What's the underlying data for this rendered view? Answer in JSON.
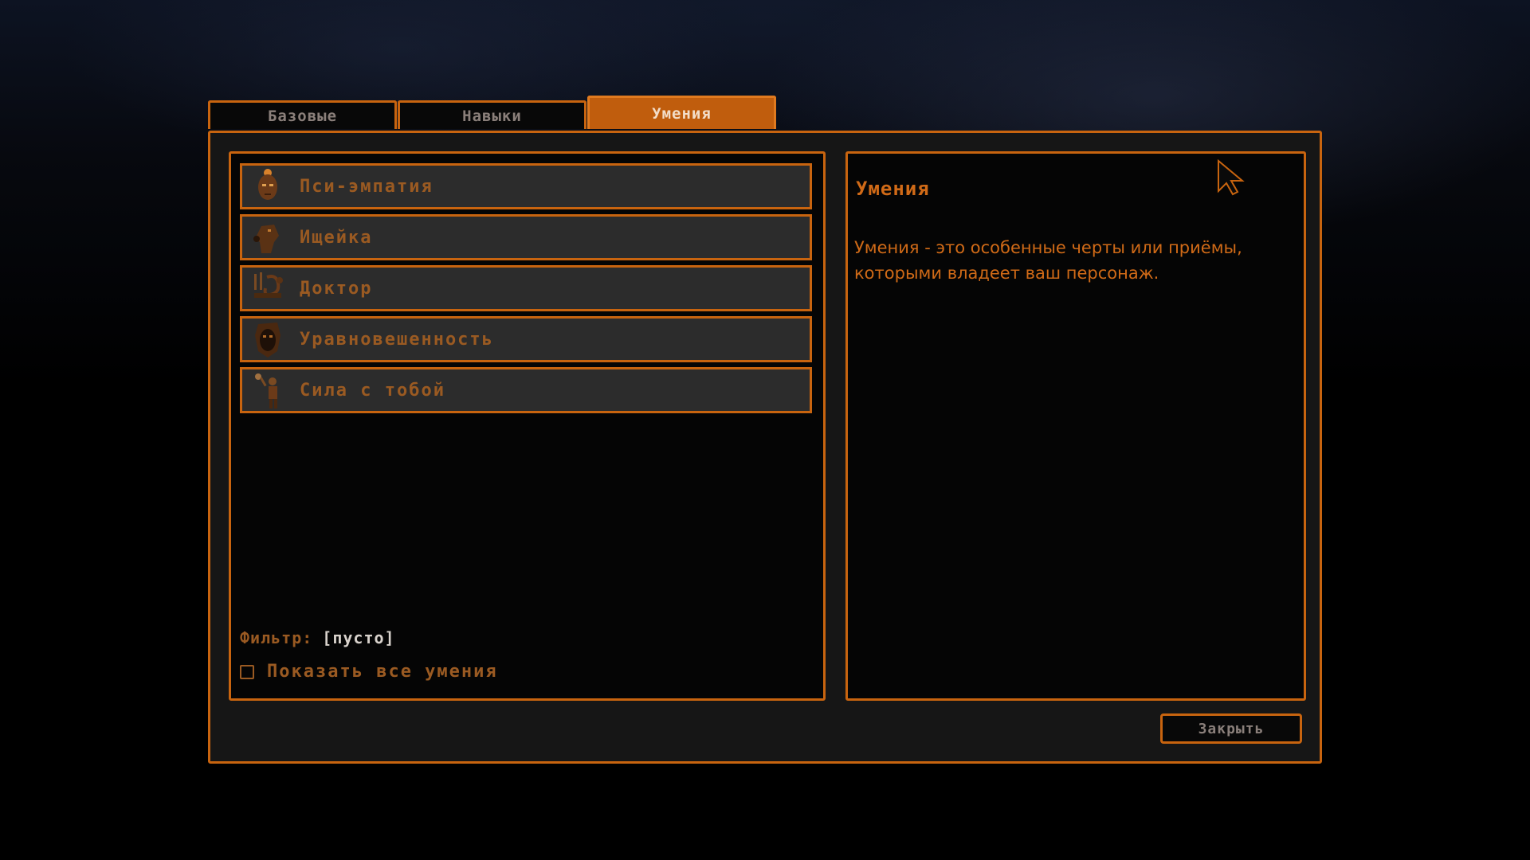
{
  "tabs": [
    {
      "label": "Базовые",
      "active": false
    },
    {
      "label": "Навыки",
      "active": false
    },
    {
      "label": "Умения",
      "active": true
    }
  ],
  "perks": [
    {
      "label": "Пси-эмпатия",
      "icon": "psi-empathy-icon"
    },
    {
      "label": "Ищейка",
      "icon": "bloodhound-icon"
    },
    {
      "label": "Доктор",
      "icon": "doctor-icon"
    },
    {
      "label": "Уравновешенность",
      "icon": "composure-icon"
    },
    {
      "label": "Сила с тобой",
      "icon": "force-icon"
    }
  ],
  "filter": {
    "label": "Фильтр:",
    "value": "[пусто]"
  },
  "show_all": {
    "label": "Показать все умения",
    "checked": false
  },
  "info": {
    "title": "Умения",
    "text": "Умения - это особенные черты или приёмы, которыми владеет ваш персонаж."
  },
  "close_label": "Закрыть",
  "colors": {
    "accent": "#c8640f",
    "active_tab": "#c05d0d",
    "label_text": "#9a5a22",
    "info_text": "#d06a17"
  }
}
